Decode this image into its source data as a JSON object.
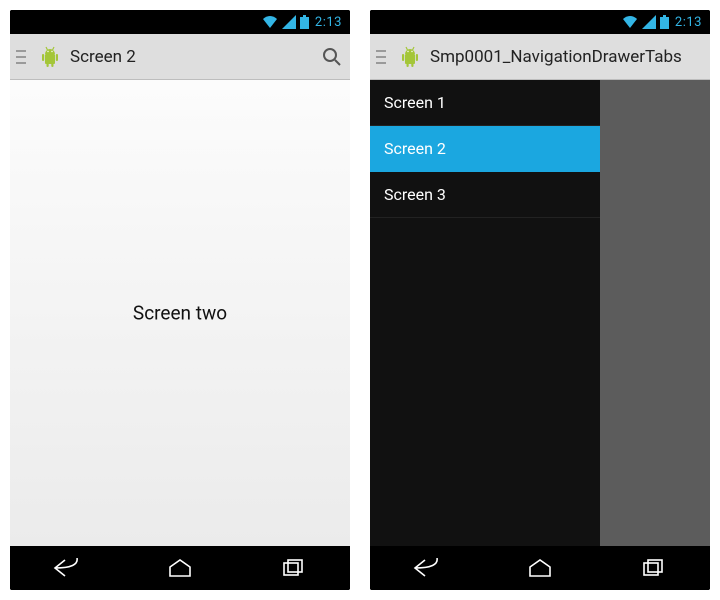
{
  "status": {
    "time": "2:13"
  },
  "left": {
    "actionbar": {
      "title": "Screen 2"
    },
    "content_label": "Screen two"
  },
  "right": {
    "actionbar": {
      "title": "Smp0001_NavigationDrawerTabs"
    },
    "drawer": {
      "items": [
        {
          "label": "Screen 1",
          "selected": false
        },
        {
          "label": "Screen 2",
          "selected": true
        },
        {
          "label": "Screen 3",
          "selected": false
        }
      ]
    }
  }
}
